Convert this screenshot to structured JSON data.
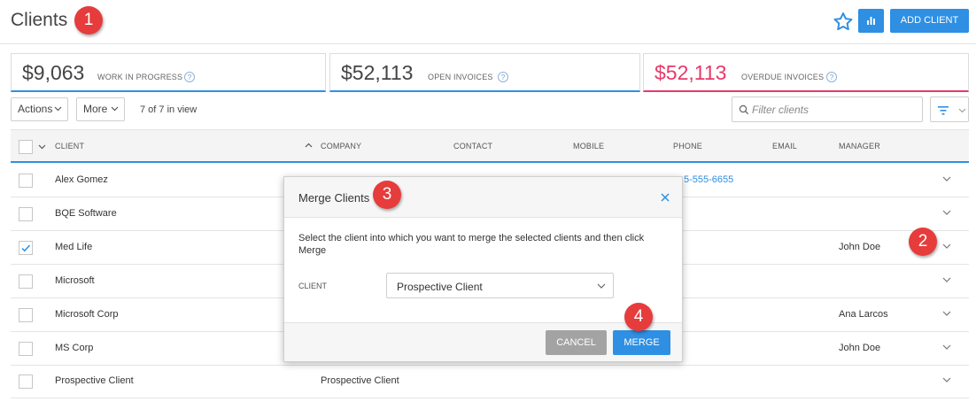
{
  "header": {
    "title": "Clients",
    "add_client_label": "ADD CLIENT"
  },
  "kpis": [
    {
      "amount": "$9,063",
      "label": "WORK IN PROGRESS"
    },
    {
      "amount": "$52,113",
      "label": "OPEN INVOICES"
    },
    {
      "amount": "$52,113",
      "label": "OVERDUE INVOICES"
    }
  ],
  "help_glyph": "?",
  "toolbar": {
    "actions_label": "Actions",
    "more_label": "More",
    "in_view": "7 of 7 in view",
    "filter_placeholder": "Filter clients"
  },
  "table": {
    "columns": [
      "CLIENT",
      "COMPANY",
      "CONTACT",
      "MOBILE",
      "PHONE",
      "EMAIL",
      "MANAGER"
    ],
    "rows": [
      {
        "client": "Alex Gomez",
        "company": "",
        "phone": "5-555-6655",
        "manager": "",
        "checked": false
      },
      {
        "client": "BQE Software",
        "company": "",
        "phone": "",
        "manager": "",
        "checked": false
      },
      {
        "client": "Med Life",
        "company": "",
        "phone": "",
        "manager": "John Doe",
        "checked": true
      },
      {
        "client": "Microsoft",
        "company": "",
        "phone": "",
        "manager": "",
        "checked": false
      },
      {
        "client": "Microsoft Corp",
        "company": "",
        "phone": "",
        "manager": "Ana Larcos",
        "checked": false
      },
      {
        "client": "MS Corp",
        "company": "",
        "phone": "",
        "manager": "John Doe",
        "checked": false
      },
      {
        "client": "Prospective Client",
        "company": "Prospective Client",
        "phone": "",
        "manager": "",
        "checked": false
      }
    ]
  },
  "modal": {
    "title": "Merge Clients",
    "message": "Select the client into which you want to merge the selected clients and then click Merge",
    "field_label": "CLIENT",
    "selected_client": "Prospective Client",
    "cancel_label": "CANCEL",
    "merge_label": "MERGE"
  },
  "callouts": [
    "1",
    "2",
    "3",
    "4"
  ],
  "colors": {
    "accent": "#2e8fe3",
    "overdue": "#e8396a",
    "callout": "#e63c3c",
    "cancel": "#a3a3a3"
  },
  "icons": {
    "title_area": "star-icon",
    "chart": "bar-chart-icon",
    "filter": "filter-icon",
    "search": "search-icon",
    "close": "close-icon",
    "row_expand": "chevron-down-icon"
  }
}
